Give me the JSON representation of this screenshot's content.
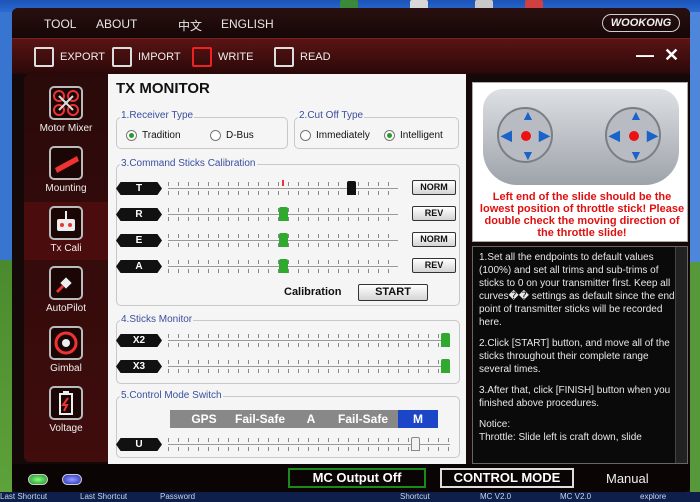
{
  "desktop": {
    "taskbar_text": [
      "Last Shortcut",
      "Last Shortcut",
      "Password",
      "Shortcut",
      "MC V2.0",
      "MC V2.0",
      "explore"
    ]
  },
  "menu": {
    "tool": "TOOL",
    "about": "ABOUT",
    "chinese": "中文",
    "english": "ENGLISH",
    "logo": "WOOKONG"
  },
  "toolbar": {
    "export": "EXPORT",
    "import": "IMPORT",
    "write": "WRITE",
    "read": "READ",
    "minimize": "—",
    "close": "✕"
  },
  "sidebar": {
    "items": [
      {
        "label": "Motor Mixer",
        "icon": "motor-mixer-icon"
      },
      {
        "label": "Mounting",
        "icon": "mounting-icon"
      },
      {
        "label": "Tx Cali",
        "icon": "remote-control-icon",
        "active": true
      },
      {
        "label": "AutoPilot",
        "icon": "satellite-icon"
      },
      {
        "label": "Gimbal",
        "icon": "gimbal-icon"
      },
      {
        "label": "Voltage",
        "icon": "battery-icon"
      }
    ]
  },
  "panel": {
    "title": "TX MONITOR",
    "receiver": {
      "label": "1.Receiver Type",
      "opt1": "Tradition",
      "opt2": "D-Bus",
      "selected": "Tradition"
    },
    "cutoff": {
      "label": "2.Cut Off Type",
      "opt1": "Immediately",
      "opt2": "Intelligent",
      "selected": "Intelligent"
    },
    "calibration": {
      "label": "3.Command Sticks Calibration",
      "channels": [
        {
          "name": "T",
          "button": "NORM",
          "level": 0.81
        },
        {
          "name": "R",
          "button": "REV",
          "level": 0.5
        },
        {
          "name": "E",
          "button": "NORM",
          "level": 0.5
        },
        {
          "name": "A",
          "button": "REV",
          "level": 0.5
        }
      ],
      "caption": "Calibration",
      "start": "START"
    },
    "sticks": {
      "label": "4.Sticks Monitor",
      "channels": [
        {
          "name": "X2",
          "level": 1.0
        },
        {
          "name": "X3",
          "level": 1.0
        }
      ]
    },
    "mode_switch": {
      "label": "5.Control Mode Switch",
      "segments": [
        "GPS",
        "Fail-Safe",
        "A",
        "Fail-Safe",
        "M"
      ],
      "selected": "M",
      "channel": "U",
      "level": 0.89
    }
  },
  "info": {
    "warning": "Left end of the slide should be the lowest position of throttle stick! Please double check the moving direction of the throttle slide!",
    "steps": [
      "1.Set all the endpoints to default values (100%) and set all trims and sub-trims of sticks to 0 on your transmitter first. Keep all curves�� settings as default since the end-point of transmitter sticks will be recorded here.",
      "2.Click [START] button, and move all of the sticks throughout their complete range several times.",
      "3.After that, click [FINISH] button when you finished above procedures.",
      "Notice:",
      "Throttle: Slide left is craft down, slide"
    ]
  },
  "status": {
    "mc_output": "MC Output Off",
    "control_mode": "CONTROL MODE",
    "mode_value": "Manual"
  },
  "colors": {
    "accent_red": "#e01010",
    "mode_selected": "#1b46c8",
    "slider_green": "#2faa2f"
  }
}
